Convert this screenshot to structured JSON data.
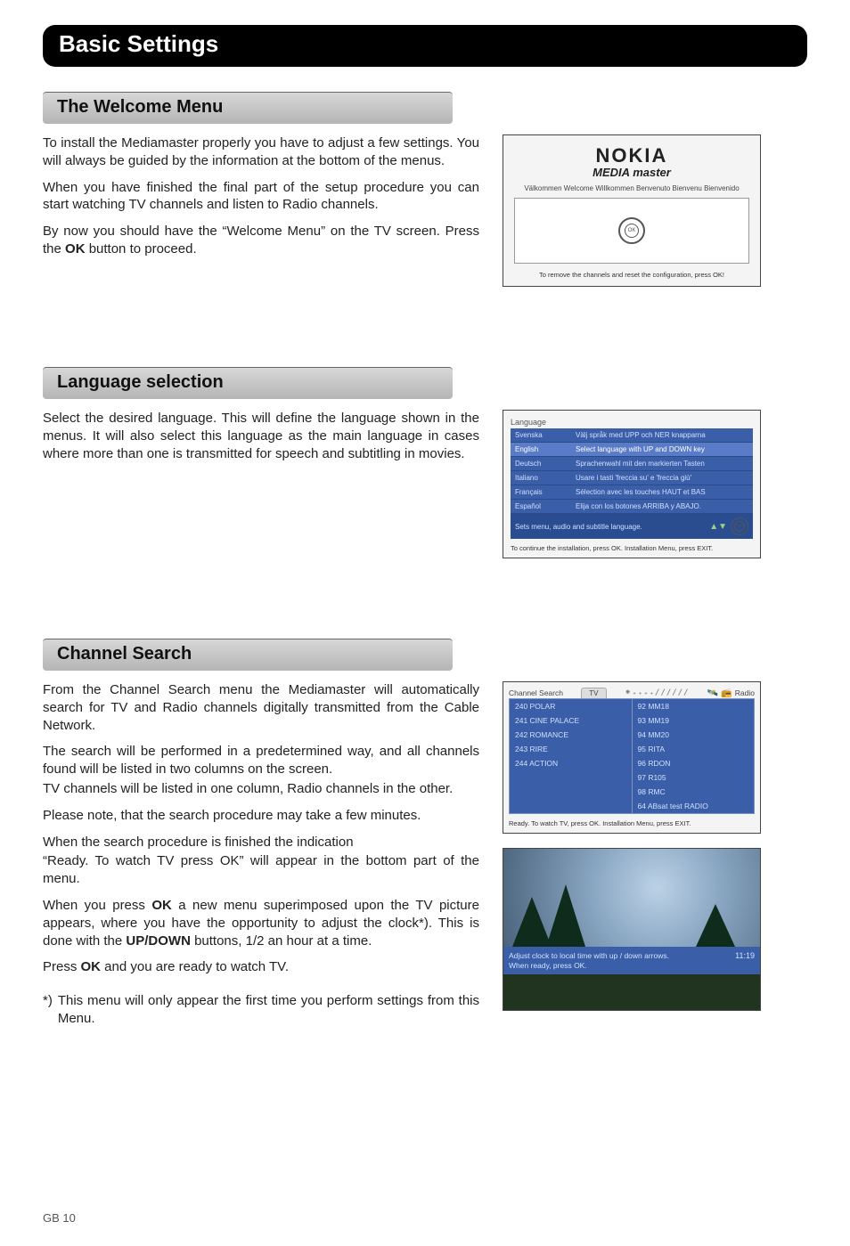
{
  "page_title": "Basic Settings",
  "page_number": "GB 10",
  "welcome": {
    "heading": "The Welcome Menu",
    "p1": "To install the Mediamaster properly you have to adjust a few settings. You will always be guided by the information at the bottom of the menus.",
    "p2": "When you have finished the final part of the setup procedure you can start watching TV channels and listen to Radio channels.",
    "p3a": "By now you should have the “Welcome Menu” on the TV screen. Press the ",
    "p3_ok": "OK",
    "p3b": " button to proceed.",
    "shot": {
      "logo_brand": "NOKIA",
      "logo_sub": "MEDIA master",
      "greeting": "Välkommen Welcome Willkommen Benvenuto Bienvenu Bienvenido",
      "ok_label": "OK",
      "footer": "To remove the channels and reset the configuration, press OK!"
    }
  },
  "language": {
    "heading": "Language selection",
    "p1": "Select the desired language. This will define the language shown in the menus. It will also select this language as the main language in cases where more than one is transmitted for speech and subtitling in movies.",
    "shot": {
      "title": "Language",
      "rows": [
        {
          "name": "Svenska",
          "hint": "Välj språk med UPP och NER knapparna"
        },
        {
          "name": "English",
          "hint": "Select language with UP and DOWN key",
          "selected": true
        },
        {
          "name": "Deutsch",
          "hint": "Sprachenwahl mit den markierten Tasten"
        },
        {
          "name": "Italiano",
          "hint": "Usare i tasti 'freccia su' e 'freccia giù'"
        },
        {
          "name": "Français",
          "hint": "Sélection avec les touches HAUT et BAS"
        },
        {
          "name": "Español",
          "hint": "Elija con los botones ARRIBA y ABAJO."
        }
      ],
      "hint_bar": "Sets menu, audio and subtitle language.",
      "ok_label": "OK",
      "footer": "To continue the installation, press OK. Installation Menu, press EXIT."
    }
  },
  "search": {
    "heading": "Channel Search",
    "p1": "From the Channel Search menu the Mediamaster will automatically search for TV and Radio channels digitally transmitted from the Cable Network.",
    "p2": "The search will be performed in a predetermined way, and all channels found will be listed in two columns on the screen.",
    "p3": "TV channels will be listed in one column, Radio channels in the other.",
    "p4": "Please note, that the search procedure may take a few minutes.",
    "p5": "When the search procedure is finished the indication",
    "p6": "“Ready. To watch TV press OK” will appear in the bottom part of the menu.",
    "p7a": "When you press ",
    "p7_ok": "OK",
    "p7b": " a new menu superimposed upon the TV picture appears, where you have the opportunity to adjust the clock*). This is done with the ",
    "p7_updown": "UP/DOWN",
    "p7c": " buttons,   1/2 an hour at a time.",
    "p8a": "Press ",
    "p8_ok": "OK",
    "p8b": " and you are ready to watch TV.",
    "footnote_marker": "*)",
    "footnote_text": "This menu will only appear the first time you perform settings from this Menu.",
    "shot": {
      "title": "Channel Search",
      "tv_tab": "TV",
      "radio_label": "Radio",
      "progress_glyph": "⁕₊₊₊₊//////",
      "tv_list": [
        "240 POLAR",
        "241 CINE PALACE",
        "242 ROMANCE",
        "243 RIRE",
        "244 ACTION"
      ],
      "radio_list": [
        "92 MM18",
        "93 MM19",
        "94 MM20",
        "95 RITA",
        "96 RDON",
        "97 R105",
        "98 RMC",
        "64 ABsat test RADIO"
      ],
      "footer": "Ready. To watch TV, press OK. Installation Menu, press EXIT."
    },
    "clock_shot": {
      "msg_line1": "Adjust clock to local time with up / down arrows.",
      "msg_line2": "When ready, press OK.",
      "time": "11:19"
    }
  }
}
